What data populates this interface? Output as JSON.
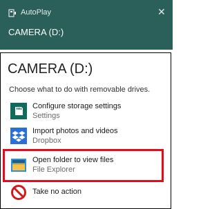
{
  "toast": {
    "app_name": "AutoPlay",
    "close_glyph": "✕",
    "drive_title": "CAMERA (D:)"
  },
  "panel": {
    "title": "CAMERA (D:)",
    "subtitle": "Choose what to do with removable drives."
  },
  "options": [
    {
      "title": "Configure storage settings",
      "subtitle": "Settings",
      "icon": "storage-card-icon"
    },
    {
      "title": "Import photos and videos",
      "subtitle": "Dropbox",
      "icon": "dropbox-icon"
    },
    {
      "title": "Open folder to view files",
      "subtitle": "File Explorer",
      "icon": "folder-icon"
    },
    {
      "title": "Take no action",
      "subtitle": "",
      "icon": "no-action-icon"
    }
  ],
  "colors": {
    "toast_bg": "#2b5f59",
    "tile_bg": "#0f6b5c",
    "dropbox_blue": "#2a6ed8",
    "highlight_red": "#e10c1b"
  }
}
